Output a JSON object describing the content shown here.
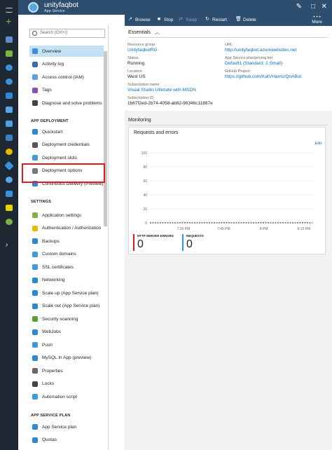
{
  "app": {
    "title": "unityfaqbot",
    "subtitle": "App Service"
  },
  "toolbar": {
    "browse": "Browse",
    "stop": "Stop",
    "swap": "Swap",
    "restart": "Restart",
    "delete": "Delete",
    "more": "More"
  },
  "menu": {
    "search_placeholder": "Search (Ctrl+/)",
    "items_top": [
      {
        "label": "Overview",
        "icon": "overview-icon",
        "color": "#3c8fd6"
      },
      {
        "label": "Activity log",
        "icon": "activity-log-icon",
        "color": "#3a6ea5"
      },
      {
        "label": "Access control (IAM)",
        "icon": "iam-icon",
        "color": "#5ea0d8"
      },
      {
        "label": "Tags",
        "icon": "tag-icon",
        "color": "#8a4fb5"
      },
      {
        "label": "Diagnose and solve problems",
        "icon": "wrench-icon",
        "color": "#444444"
      }
    ],
    "section_deploy": "APP DEPLOYMENT",
    "items_deploy": [
      {
        "label": "Quickstart",
        "icon": "cloud-icon",
        "color": "#2f86d1"
      },
      {
        "label": "Deployment credentials",
        "icon": "credentials-icon",
        "color": "#555555"
      },
      {
        "label": "Deployment slots",
        "icon": "slots-icon",
        "color": "#3f9ad9"
      },
      {
        "label": "Deployment options",
        "icon": "gear-icon",
        "color": "#777777"
      },
      {
        "label": "Continuous Delivery (Preview)",
        "icon": "delivery-icon",
        "color": "#2f86d1"
      }
    ],
    "section_settings": "SETTINGS",
    "items_settings": [
      {
        "label": "Application settings",
        "icon": "app-settings-icon",
        "color": "#7cb342"
      },
      {
        "label": "Authentication / Authorization",
        "icon": "key-icon",
        "color": "#e6b800"
      },
      {
        "label": "Backups",
        "icon": "backup-icon",
        "color": "#2f86d1"
      },
      {
        "label": "Custom domains",
        "icon": "domain-icon",
        "color": "#3f9ad9"
      },
      {
        "label": "SSL certificates",
        "icon": "certificate-icon",
        "color": "#3f9ad9"
      },
      {
        "label": "Networking",
        "icon": "networking-icon",
        "color": "#2f86d1"
      },
      {
        "label": "Scale up (App Service plan)",
        "icon": "scale-up-icon",
        "color": "#2f86d1"
      },
      {
        "label": "Scale out (App Service plan)",
        "icon": "scale-out-icon",
        "color": "#2f86d1"
      },
      {
        "label": "Security scanning",
        "icon": "shield-icon",
        "color": "#5aa02c"
      },
      {
        "label": "WebJobs",
        "icon": "webjobs-icon",
        "color": "#2f86d1"
      },
      {
        "label": "Push",
        "icon": "push-icon",
        "color": "#3f9ad9"
      },
      {
        "label": "MySQL In App (preview)",
        "icon": "mysql-icon",
        "color": "#2f86d1"
      },
      {
        "label": "Properties",
        "icon": "properties-icon",
        "color": "#666666"
      },
      {
        "label": "Locks",
        "icon": "lock-icon",
        "color": "#444444"
      },
      {
        "label": "Automation script",
        "icon": "script-icon",
        "color": "#3f9ad9"
      }
    ],
    "section_plan": "APP SERVICE PLAN",
    "items_plan": [
      {
        "label": "App Service plan",
        "icon": "plan-icon",
        "color": "#2f86d1"
      },
      {
        "label": "Quotas",
        "icon": "quota-icon",
        "color": "#2f86d1"
      }
    ]
  },
  "essentials": {
    "title": "Essentials",
    "resource_group_label": "Resource group",
    "resource_group": "UnityfaqbotRG",
    "status_label": "Status",
    "status": "Running",
    "location_label": "Location",
    "location": "West US",
    "subscription_name_label": "Subscription name",
    "subscription_name": "Visual Studio Ultimate with MSDN",
    "subscription_id_label": "Subscription ID",
    "subscription_id": "1b67f2ed-2b74-4058-ab82-96346c11887e",
    "url_label": "URL",
    "url": "http://unityfaqbot.azurewebsites.net",
    "plan_label": "App Service plan/pricing tier",
    "plan": "Default1 (Standard: 1 Small)",
    "github_label": "GitHub Project",
    "github": "https://github.com/KatVHarris/QnABot"
  },
  "monitoring": {
    "title": "Monitoring",
    "tile_title": "Requests and errors",
    "edit": "Edit",
    "http_errors_label": "HTTP SERVER ERRORS",
    "http_errors": "0",
    "requests_label": "REQUESTS",
    "requests": "0"
  },
  "chart_data": {
    "type": "line",
    "title": "Requests and errors",
    "x": [
      "7:30 PM",
      "7:45 PM",
      "8 PM",
      "8:15 PM"
    ],
    "y_ticks": [
      100,
      80,
      60,
      40,
      20,
      0
    ],
    "ylim": [
      0,
      100
    ],
    "series": [
      {
        "name": "HTTP SERVER ERRORS",
        "values": [
          0,
          0,
          0,
          0
        ],
        "color": "#e01b24"
      },
      {
        "name": "REQUESTS",
        "values": [
          0,
          0,
          0,
          0
        ],
        "color": "#1ea0e6"
      }
    ]
  },
  "colors": {
    "accent": "#0072c6",
    "header": "#2d4e6f",
    "nav": "#1e2833",
    "active": "#c4e2f6",
    "highlight": "#e01b24"
  }
}
